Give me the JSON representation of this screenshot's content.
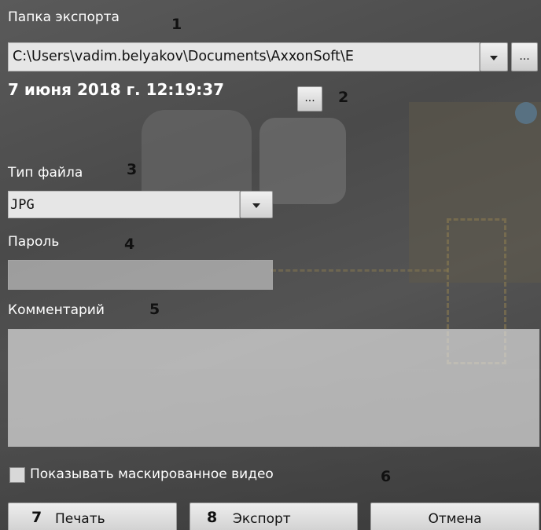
{
  "export_folder": {
    "label": "Папка экспорта",
    "marker": "1",
    "path": "C:\\Users\\vadim.belyakov\\Documents\\AxxonSoft\\E",
    "browse_label": "..."
  },
  "datetime": {
    "value": "7 июня 2018 г. 12:19:37",
    "picker_label": "...",
    "marker": "2"
  },
  "file_type": {
    "label": "Тип файла",
    "marker": "3",
    "selected": "JPG"
  },
  "password": {
    "label": "Пароль",
    "marker": "4",
    "value": ""
  },
  "comment": {
    "label": "Комментарий",
    "marker": "5",
    "value": ""
  },
  "masked_video": {
    "label": "Показывать маскированное видео",
    "marker": "6",
    "checked": false
  },
  "buttons": {
    "print": {
      "label": "Печать",
      "marker": "7"
    },
    "export": {
      "label": "Экспорт",
      "marker": "8"
    },
    "cancel": {
      "label": "Отмена"
    }
  },
  "colors": {
    "label_text": "#ffffff",
    "marker_text": "#111111",
    "field_bg": "#e6e6e6"
  }
}
